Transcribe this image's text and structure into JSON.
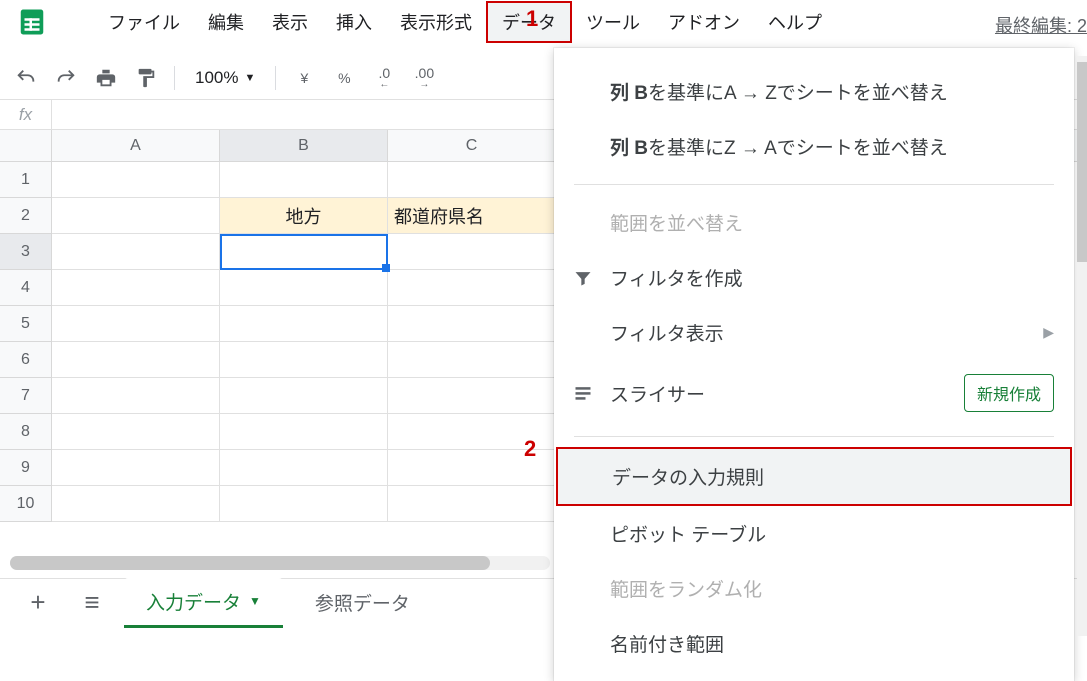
{
  "menubar": {
    "items": [
      "ファイル",
      "編集",
      "表示",
      "挿入",
      "表示形式",
      "データ",
      "ツール",
      "アドオン",
      "ヘルプ"
    ],
    "last_edit": "最終編集: 2"
  },
  "toolbar": {
    "zoom": "100%",
    "currency": "¥",
    "percent": "%",
    "dec_dec": ".0",
    "dec_inc": ".00"
  },
  "fx": {
    "label": "fx"
  },
  "columns": [
    "A",
    "B",
    "C"
  ],
  "rows": [
    "1",
    "2",
    "3",
    "4",
    "5",
    "6",
    "7",
    "8",
    "9",
    "10"
  ],
  "cells": {
    "b2": "地方",
    "c2": "都道府県名"
  },
  "tabs": {
    "active": "入力データ",
    "other": "参照データ"
  },
  "dropdown": {
    "sort_col_prefix": "列 B",
    "sort_az_suffix": " を基準にA → Zでシートを並べ替え",
    "sort_za_suffix": " を基準にZ → Aでシートを並べ替え",
    "sort_range": "範囲を並べ替え",
    "filter_create": "フィルタを作成",
    "filter_view": "フィルタ表示",
    "slicer": "スライサー",
    "slicer_badge": "新規作成",
    "data_validation": "データの入力規則",
    "pivot": "ピボット テーブル",
    "randomize": "範囲をランダム化",
    "named_range": "名前付き範囲"
  },
  "annotations": {
    "a1": "1",
    "a2": "2"
  }
}
